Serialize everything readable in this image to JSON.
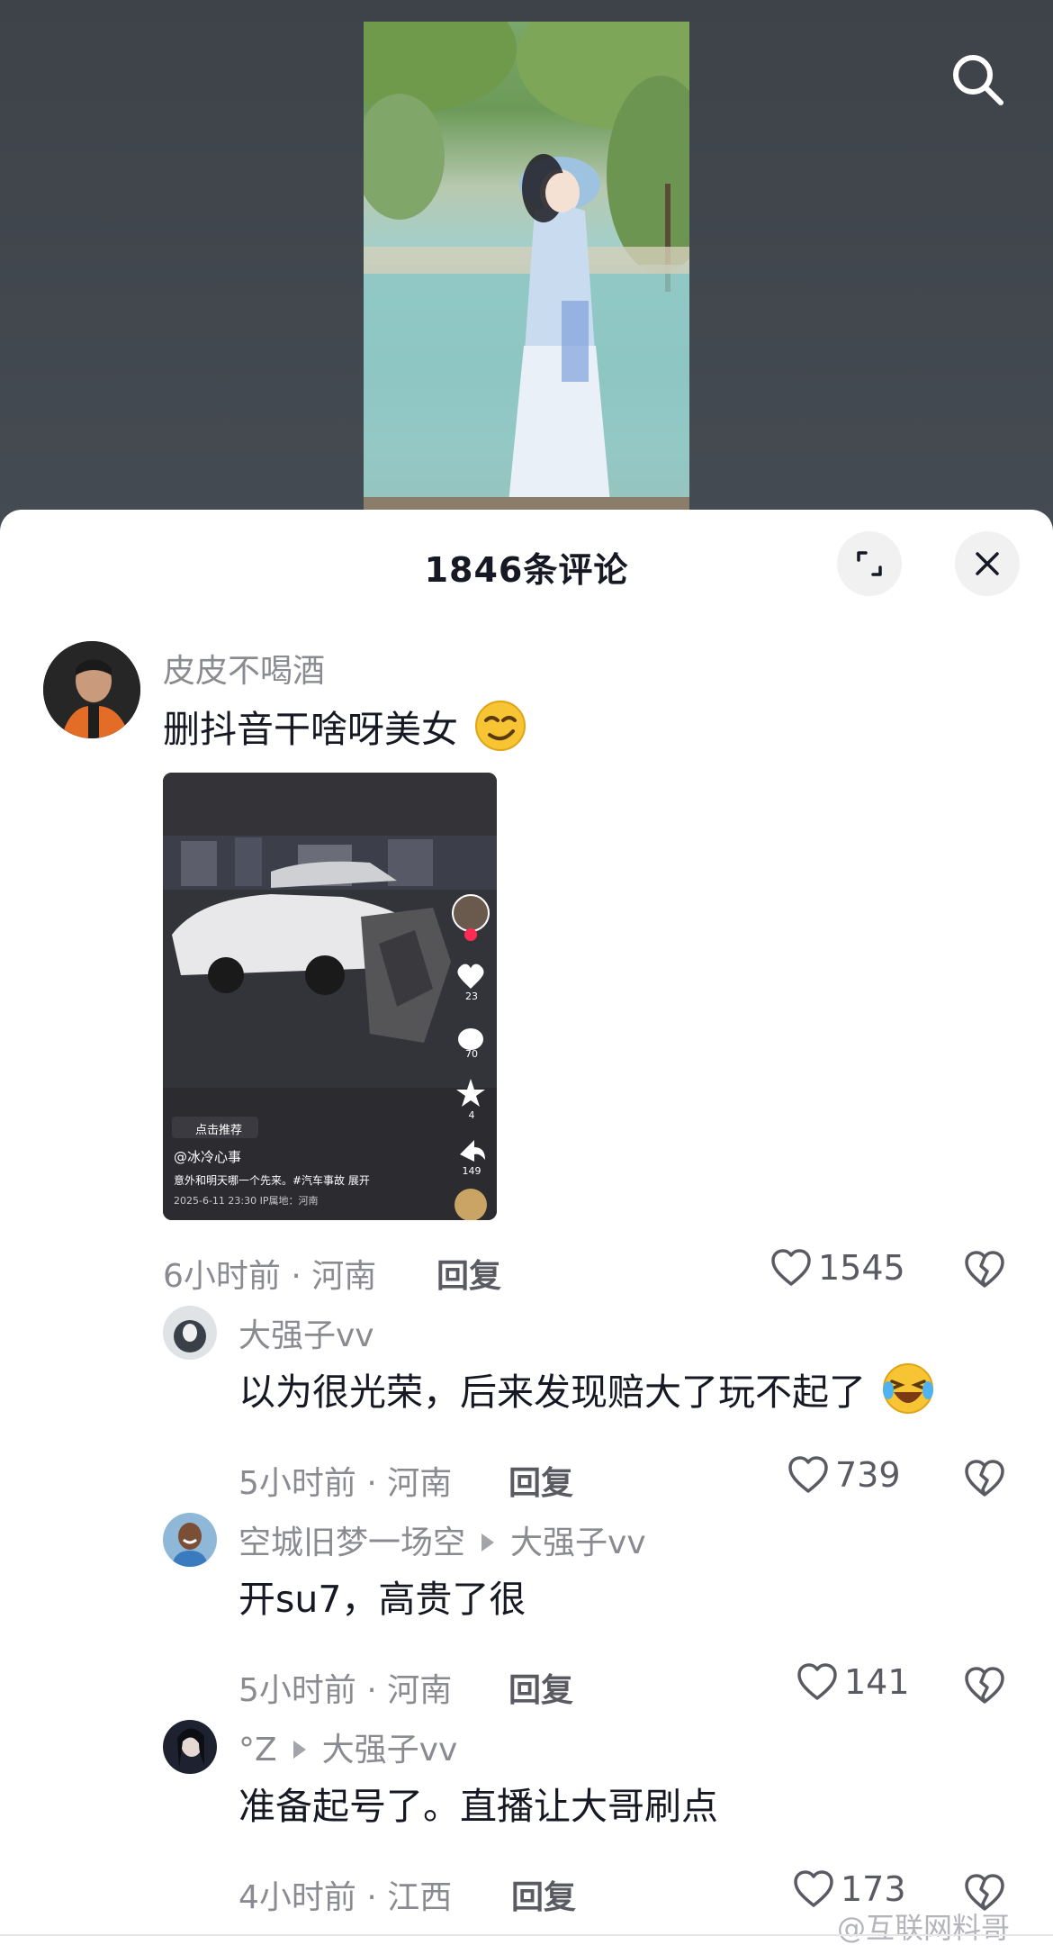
{
  "video": {
    "search_icon": "search-icon"
  },
  "sheet": {
    "title": "1846条评论",
    "expand_icon": "expand-icon",
    "close_icon": "close-icon"
  },
  "comments": [
    {
      "username": "皮皮不喝酒",
      "text": "删抖音干啥呀美女",
      "emoji": "smirk-emoji",
      "time_location": "6小时前 · 河南",
      "reply_label": "回复",
      "likes": "1545",
      "attached_image": {
        "handle": "@冰冷心事",
        "recommend_label": "点击推荐",
        "caption": "意外和明天哪一个先来。#汽车事故 展开",
        "date_ip": "2025-6-11 23:30  IP属地：河南",
        "side_counts": [
          "23",
          "70",
          "4",
          "149"
        ]
      }
    },
    {
      "username": "大强子vv",
      "text": "以为很光荣，后来发现赔大了玩不起了",
      "emoji": "laugh-cry-emoji",
      "time_location": "5小时前 · 河南",
      "reply_label": "回复",
      "likes": "739"
    },
    {
      "username": "空城旧梦一场空",
      "reply_to": "大强子vv",
      "text": "开su7，高贵了很",
      "time_location": "5小时前 · 河南",
      "reply_label": "回复",
      "likes": "141"
    },
    {
      "username": "°Z",
      "reply_to": "大强子vv",
      "text": "准备起号了。直播让大哥刷点",
      "time_location": "4小时前 · 江西",
      "reply_label": "回复",
      "likes": "173"
    }
  ],
  "watermark": "@互联网料哥",
  "colors": {
    "background_top": "#41474d",
    "sheet": "#ffffff",
    "text_primary": "#161823",
    "text_secondary": "#8a8b91"
  }
}
